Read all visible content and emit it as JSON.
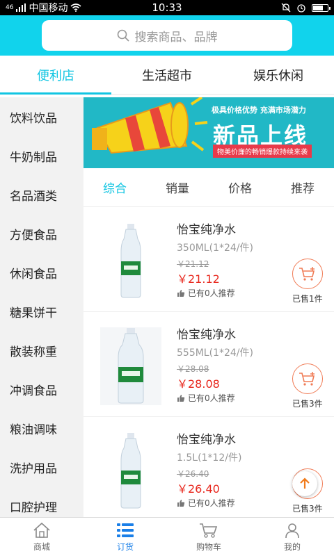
{
  "status_bar": {
    "carrier": "中国移动",
    "signal_label": "46",
    "time": "10:33"
  },
  "search": {
    "placeholder": "搜索商品、品牌"
  },
  "top_tabs": [
    {
      "label": "便利店",
      "active": true
    },
    {
      "label": "生活超市",
      "active": false
    },
    {
      "label": "娱乐休闲",
      "active": false
    }
  ],
  "categories": [
    "饮料饮品",
    "牛奶制品",
    "名品酒类",
    "方便食品",
    "休闲食品",
    "糖果饼干",
    "散装称重",
    "冲调食品",
    "粮油调味",
    "洗护用品",
    "口腔护理"
  ],
  "banner": {
    "tagline": "极具价格优势 充满市场潜力",
    "headline": "新品上线",
    "strip": "物美价廉的畅销爆款持续来袭"
  },
  "sort_options": [
    {
      "label": "综合",
      "active": true
    },
    {
      "label": "销量",
      "active": false
    },
    {
      "label": "价格",
      "active": false
    },
    {
      "label": "推荐",
      "active": false
    }
  ],
  "products": [
    {
      "name": "怡宝纯净水",
      "spec": "350ML(1*24/件)",
      "old_price": "￥21.12",
      "price": "￥21.12",
      "recommend": "已有0人推荐",
      "sold": "已售1件"
    },
    {
      "name": "怡宝纯净水",
      "spec": "555ML(1*24/件)",
      "old_price": "￥28.08",
      "price": "￥28.08",
      "recommend": "已有0人推荐",
      "sold": "已售3件"
    },
    {
      "name": "怡宝纯净水",
      "spec": "1.5L(1*12/件)",
      "old_price": "￥26.40",
      "price": "￥26.40",
      "recommend": "已有0人推荐",
      "sold": "已售3件"
    }
  ],
  "bottom_nav": [
    {
      "label": "商城",
      "icon": "home-icon",
      "active": false
    },
    {
      "label": "订货",
      "icon": "list-icon",
      "active": true
    },
    {
      "label": "购物车",
      "icon": "cart-icon",
      "active": false
    },
    {
      "label": "我的",
      "icon": "user-icon",
      "active": false
    }
  ],
  "colors": {
    "accent": "#11c5e2",
    "header_bg": "#11d3ec",
    "price_red": "#e8281e",
    "nav_active": "#1a7fe8"
  }
}
